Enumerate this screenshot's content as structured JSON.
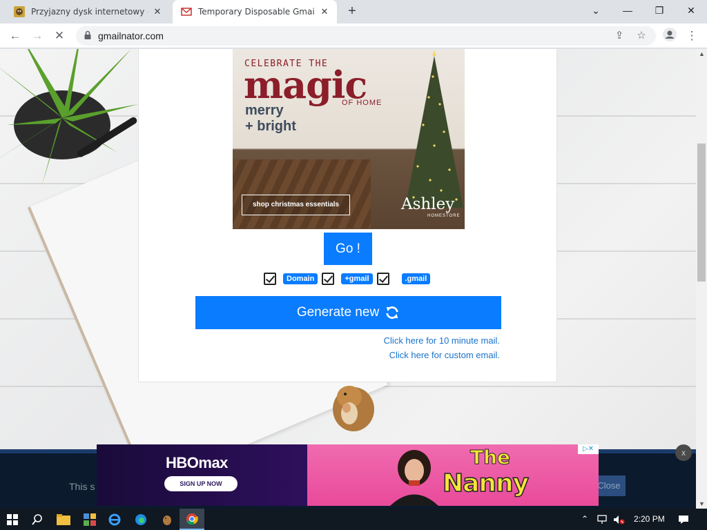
{
  "browser": {
    "tabs": [
      {
        "title": "Przyjazny dysk internetowy - Cho",
        "active": false
      },
      {
        "title": "Temporary Disposable Gmail | Te",
        "active": true
      }
    ],
    "new_tab_glyph": "+",
    "window_controls": {
      "minimize": "—",
      "restore": "❐",
      "close": "✕",
      "tab_list": "⌄"
    },
    "url": "gmailnator.com",
    "nav": {
      "back": "←",
      "forward": "→",
      "stop": "✕"
    }
  },
  "ad_top": {
    "celebrate": "CELEBRATE THE",
    "magic": "magic",
    "of_home": "OF HOME",
    "merry": "merry",
    "bright": "+ bright",
    "shop_button": "shop christmas essentials",
    "brand": "Ashley",
    "brand_sub": "HOMESTORE"
  },
  "form": {
    "go_button": "Go !",
    "options": [
      {
        "label": "Domain",
        "checked": true
      },
      {
        "label": "+gmail",
        "checked": true
      },
      {
        "label": ".gmail",
        "checked": true
      }
    ],
    "generate_button": "Generate new",
    "link_10min": "Click here for 10 minute mail.",
    "link_custom": "Click here for custom email."
  },
  "cookie": {
    "text": "This s",
    "close": "Close"
  },
  "banner_ad": {
    "hbo_logo": "HBOmax",
    "hbo_signup": "SIGN UP NOW",
    "show_the": "The",
    "show_name": "Nanny",
    "close": "x",
    "adchoices": "▷✕"
  },
  "taskbar": {
    "time": "2:20 PM"
  },
  "colors": {
    "accent": "#0a7cff",
    "link": "#1a73c8"
  }
}
